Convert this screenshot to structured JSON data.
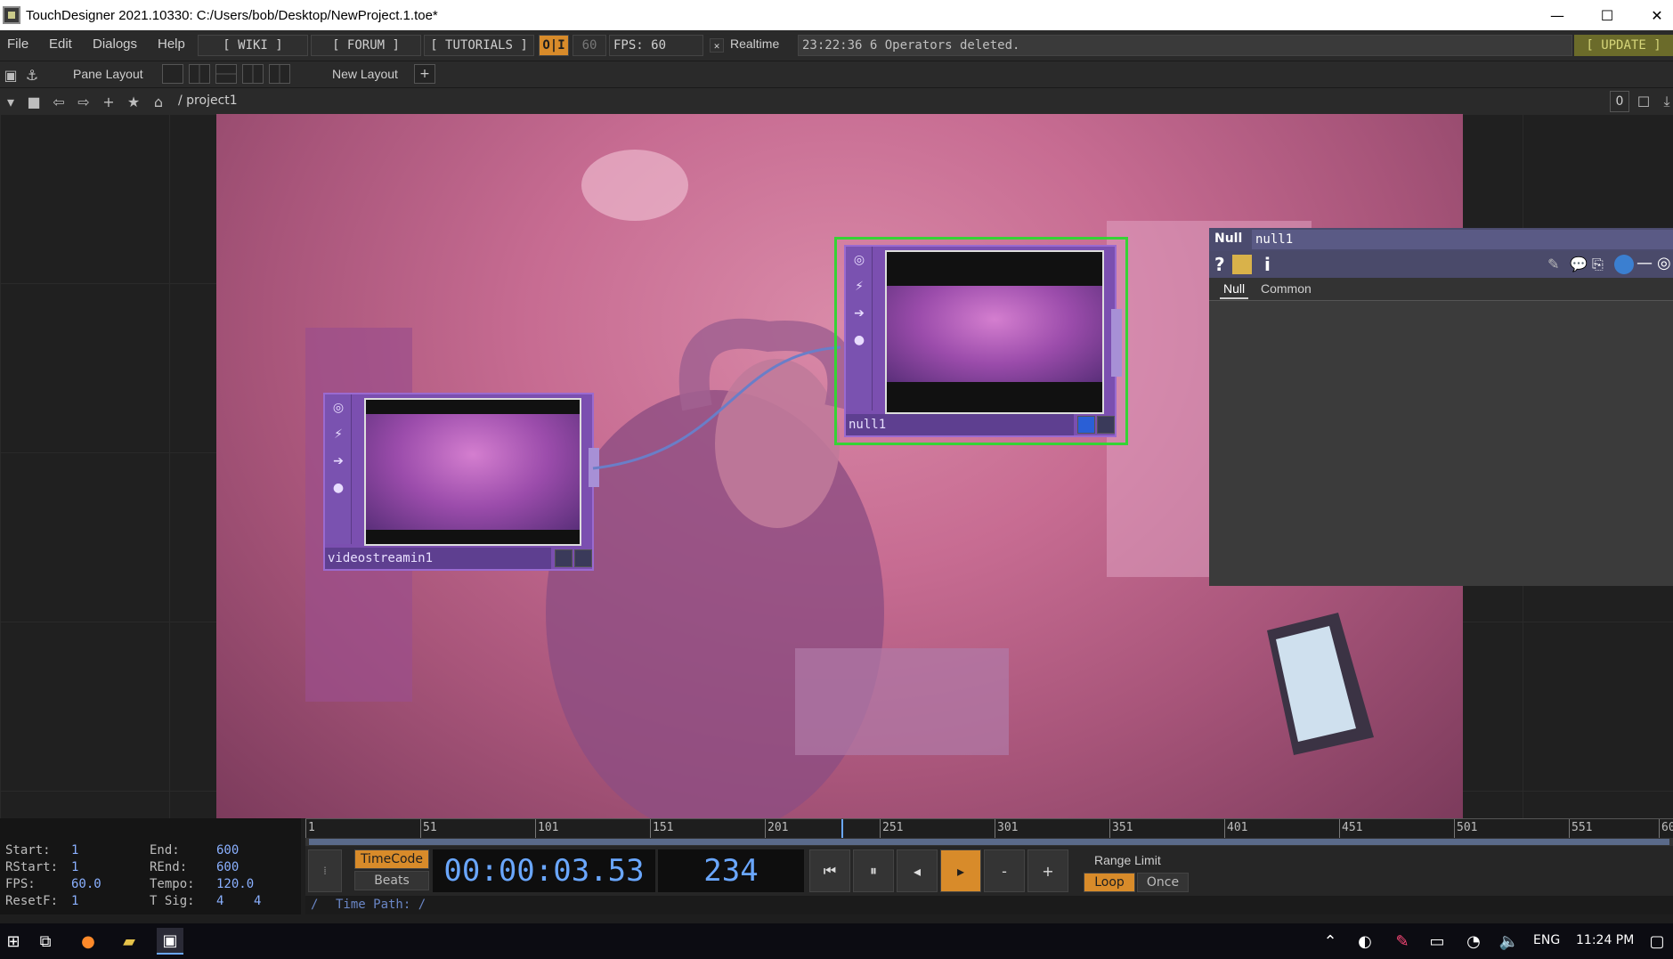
{
  "window": {
    "title": "TouchDesigner 2021.10330: C:/Users/bob/Desktop/NewProject.1.toe*",
    "minimize": "—",
    "maximize": "☐",
    "close": "✕"
  },
  "menubar": {
    "file": "File",
    "edit": "Edit",
    "dialogs": "Dialogs",
    "help": "Help",
    "wiki": "[ WIKI ]",
    "forum": "[ FORUM ]",
    "tutorials": "[ TUTORIALS ]",
    "oi": "O|I",
    "fps_cap": "60",
    "fps": "FPS:  60",
    "realtime_check": "✕",
    "realtime": "Realtime",
    "status": "23:22:36 6 Operators deleted.",
    "update": "[ UPDATE ]"
  },
  "toolbar1": {
    "pane_layout": "Pane Layout",
    "new_layout": "New Layout",
    "add": "+"
  },
  "toolbar2": {
    "path": "/ project1",
    "counter": "0"
  },
  "nodes": {
    "videostream": {
      "label": "videostreamin1"
    },
    "null": {
      "label": "null1"
    }
  },
  "params": {
    "type": "Null",
    "name": "null1",
    "tabs": [
      "Null",
      "Common"
    ],
    "help_icon": "?",
    "info_icon": "i"
  },
  "timeline": {
    "ticks": [
      "1",
      "51",
      "101",
      "151",
      "201",
      "251",
      "301",
      "351",
      "401",
      "451",
      "501",
      "551",
      "60"
    ],
    "info": {
      "start_label": "Start:",
      "start": "1",
      "end_label": "End:",
      "end": "600",
      "rstart_label": "RStart:",
      "rstart": "1",
      "rend_label": "REnd:",
      "rend": "600",
      "fps_label": "FPS:",
      "fps": "60.0",
      "tempo_label": "Tempo:",
      "tempo": "120.0",
      "resetf_label": "ResetF:",
      "resetf": "1",
      "tsig_label": "T Sig:",
      "tsig_a": "4",
      "tsig_b": "4"
    },
    "timecode_btn": "TimeCode",
    "beats_btn": "Beats",
    "timecode": "00:00:03.53",
    "frame": "234",
    "range_limit": "Range Limit",
    "loop": "Loop",
    "once": "Once",
    "minus": "-",
    "plus": "+",
    "time_path": "Time Path: /",
    "slash": "/"
  },
  "taskbar": {
    "lang": "ENG",
    "clock": "11:24 PM"
  },
  "colors": {
    "accent_orange": "#d88b2a",
    "node_purple": "#7b4fb0",
    "selected_green": "#35d335",
    "timecode_blue": "#6aa7ff"
  }
}
